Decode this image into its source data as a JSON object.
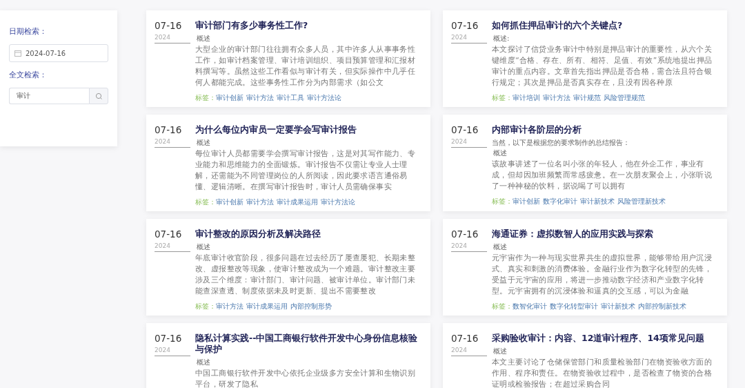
{
  "sidebar": {
    "date_label": "日期检索：",
    "date_value": "2024-07-16",
    "search_label": "全文检索：",
    "search_value": "审计"
  },
  "articles": [
    {
      "date": "07-16",
      "year": "2024",
      "title": "审计部门有多少事务性工作?",
      "summary_label": "概述",
      "summary": "大型企业的审计部门往往拥有众多人员，其中许多人从事事务性工作，如审计档案管理、审计培训组织、项目预算管理和汇报材料撰写等。虽然这些工作看似与审计有关，但实际操作中几乎任何人都能完成。这些事务性工作分为内部需求（如公文",
      "tags_label": "标签：",
      "tags": [
        "审计创新",
        "审计方法",
        "审计工具",
        "审计方法论"
      ]
    },
    {
      "date": "07-16",
      "year": "2024",
      "title": "如何抓住押品审计的六个关键点?",
      "summary_label": "概述:",
      "summary": "本文探讨了信贷业务审计中特别是押品审计的重要性，从六个关键维度“合格、存在、所有、相符、足值、有效”系统地提出押品审计的重点内容。文章首先指出押品是否合格，需合法且符合银行规定；其次是押品是否真实存在，且没有因各种原",
      "tags_label": "标签：",
      "tags": [
        "审计培训",
        "审计方法",
        "审计规范",
        "风险管理规范"
      ]
    },
    {
      "date": "07-16",
      "year": "2024",
      "title": "为什么每位内审员一定要学会写审计报告",
      "summary_label": "概述",
      "summary": "每位审计人员都需要学会撰写审计报告，这是对其写作能力、专业能力和思维能力的全面锻炼。审计报告不仅需让专业人士理解，还需能为不同管理岗位的人所阅读，因此要求语言通俗易懂、逻辑清晰。在撰写审计报告时，审计人员需确保事实",
      "tags_label": "标签：",
      "tags": [
        "审计创新",
        "审计方法",
        "审计成果运用",
        "审计方法论"
      ]
    },
    {
      "date": "07-16",
      "year": "2024",
      "title": "内部审计各阶层的分析",
      "intro": "当然，以下是根据您的要求制作的总结报告：",
      "summary_label": "概述",
      "summary": "该故事讲述了一位名叫小张的年轻人，他在外企工作，事业有成，但却因加班频繁而常感疲惫。在一次朋友聚会上，小张听说了一种神秘的饮料，据说喝了可以拥有",
      "tags_label": "标签：",
      "tags": [
        "审计创新",
        "数字化审计",
        "审计新技术",
        "风险管理新技术"
      ]
    },
    {
      "date": "07-16",
      "year": "2024",
      "title": "审计整改的原因分析及解决路径",
      "summary_label": "概述",
      "summary": "年底审计收官阶段，很多问题在过去经历了屡查屡犯、长期未整改、虚报整改等现象，使审计整改成为一个难题。审计整改主要涉及三个维度：审计部门、审计问题、被审计单位。审计部门未能查深查透、制度依据未及时更新、提出不需要整改",
      "tags_label": "标签：",
      "tags": [
        "审计方法",
        "审计成果运用",
        "内部控制形势"
      ]
    },
    {
      "date": "07-16",
      "year": "2024",
      "title": "海通证券：虚拟数智人的应用实践与探索",
      "summary_label": "概述",
      "summary": "元宇宙作为一种与现实世界共生的虚拟世界，能够带给用户沉浸式、真实和刺激的消费体验。金融行业作为数字化转型的先锋，受益于元宇宙的应用，将进一步推动数字经济和产业数字化转型。元宇宙拥有的沉浸体验和逼真的交互感，可以为金融",
      "tags_label": "标签：",
      "tags": [
        "数智化审计",
        "数字化转型审计",
        "审计新技术",
        "内部控制新技术"
      ]
    },
    {
      "date": "07-16",
      "year": "2024",
      "title": "隐私计算实践--中国工商银行软件开发中心身份信息核验与保护",
      "summary_label": "概述",
      "summary": "中国工商银行软件开发中心依托企业级多方安全计算和生物识别平台，研发了隐私"
    },
    {
      "date": "07-16",
      "year": "2024",
      "title": "采购验收审计：内容、12道审计程序、14项常见问题",
      "summary_label": "概述",
      "summary": "本文主要讨论了仓储保管部门和质量检验部门在物资验收方面的作用、程序和责任。在物资验收过程中，是否检查了物资的合格证明或检验报告；在超过采购合同"
    }
  ]
}
